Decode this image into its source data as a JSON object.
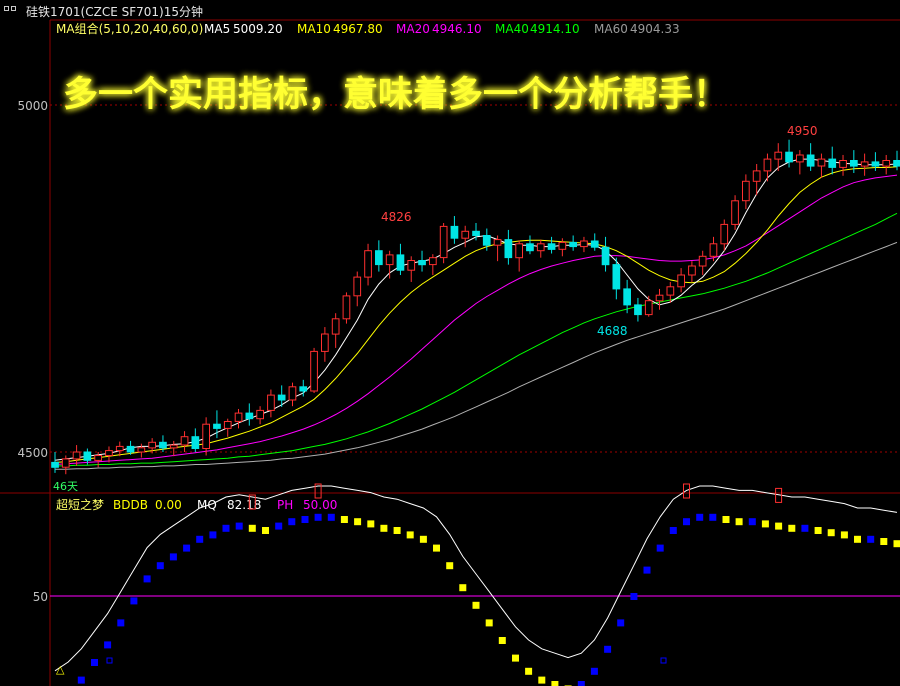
{
  "window": {
    "title": "硅铁1701(CZCE SF701)15分钟"
  },
  "banner": "多一个实用指标，意味着多一个分析帮手！",
  "colors": {
    "background": "#000000",
    "axis": "#8b0000",
    "up": "#ff3030",
    "down": "#00e5e5",
    "ma5": "#ffffff",
    "ma10": "#ffff00",
    "ma20": "#ff00ff",
    "ma40": "#00ff00",
    "ma60": "#b0b0b0",
    "banner": "#ffff33",
    "bddb": "#ffff00",
    "mq": "#ffffff",
    "ph": "#ff00ff",
    "blue": "#0000ff"
  },
  "main_legend": {
    "group_label": "MA组合(5,10,20,40,60,0)",
    "items": [
      {
        "name": "MA5",
        "value": "5009.20",
        "color": "#ffffff"
      },
      {
        "name": "MA10",
        "value": "4967.80",
        "color": "#ffff00"
      },
      {
        "name": "MA20",
        "value": "4946.10",
        "color": "#ff00ff"
      },
      {
        "name": "MA40",
        "value": "4914.10",
        "color": "#00ff00"
      },
      {
        "name": "MA60",
        "value": "4904.33",
        "color": "#9a9a9a"
      }
    ]
  },
  "sub_legend": {
    "name": "超短之梦",
    "items": [
      {
        "name": "BDDB",
        "value": "0.00",
        "color": "#ffff00"
      },
      {
        "name": "MQ",
        "value": "82.18",
        "color": "#ffffff"
      },
      {
        "name": "PH",
        "value": "50.00",
        "color": "#ff00ff"
      }
    ]
  },
  "annotations": {
    "high1": "4826",
    "low1": "4688",
    "high2": "4950",
    "days": "46天",
    "triangle": "△"
  },
  "chart_data": [
    {
      "type": "candlestick",
      "ylim": [
        4480,
        5050
      ],
      "y_ticks": [
        5000,
        4500
      ],
      "ohlc": [
        [
          4485,
          4500,
          4470,
          4478
        ],
        [
          4478,
          4495,
          4468,
          4490
        ],
        [
          4490,
          4510,
          4480,
          4500
        ],
        [
          4500,
          4505,
          4482,
          4488
        ],
        [
          4488,
          4500,
          4478,
          4495
        ],
        [
          4495,
          4508,
          4485,
          4502
        ],
        [
          4502,
          4515,
          4494,
          4508
        ],
        [
          4508,
          4516,
          4496,
          4500
        ],
        [
          4500,
          4512,
          4492,
          4506
        ],
        [
          4506,
          4520,
          4498,
          4514
        ],
        [
          4514,
          4524,
          4500,
          4506
        ],
        [
          4506,
          4516,
          4494,
          4510
        ],
        [
          4510,
          4530,
          4500,
          4522
        ],
        [
          4522,
          4534,
          4500,
          4505
        ],
        [
          4505,
          4550,
          4495,
          4540
        ],
        [
          4540,
          4560,
          4520,
          4534
        ],
        [
          4534,
          4548,
          4522,
          4544
        ],
        [
          4544,
          4562,
          4534,
          4556
        ],
        [
          4556,
          4570,
          4538,
          4548
        ],
        [
          4548,
          4566,
          4540,
          4560
        ],
        [
          4560,
          4590,
          4550,
          4582
        ],
        [
          4582,
          4596,
          4565,
          4575
        ],
        [
          4575,
          4600,
          4566,
          4594
        ],
        [
          4594,
          4604,
          4580,
          4588
        ],
        [
          4588,
          4650,
          4585,
          4645
        ],
        [
          4645,
          4680,
          4630,
          4670
        ],
        [
          4670,
          4700,
          4650,
          4692
        ],
        [
          4692,
          4730,
          4685,
          4725
        ],
        [
          4725,
          4760,
          4710,
          4752
        ],
        [
          4752,
          4800,
          4740,
          4790
        ],
        [
          4790,
          4805,
          4760,
          4770
        ],
        [
          4770,
          4790,
          4750,
          4784
        ],
        [
          4784,
          4800,
          4755,
          4762
        ],
        [
          4762,
          4782,
          4745,
          4776
        ],
        [
          4776,
          4790,
          4760,
          4770
        ],
        [
          4770,
          4785,
          4755,
          4780
        ],
        [
          4780,
          4830,
          4772,
          4825
        ],
        [
          4825,
          4840,
          4800,
          4808
        ],
        [
          4808,
          4826,
          4795,
          4818
        ],
        [
          4818,
          4830,
          4805,
          4812
        ],
        [
          4812,
          4822,
          4790,
          4798
        ],
        [
          4798,
          4812,
          4775,
          4806
        ],
        [
          4806,
          4820,
          4770,
          4780
        ],
        [
          4780,
          4805,
          4760,
          4800
        ],
        [
          4800,
          4812,
          4785,
          4790
        ],
        [
          4790,
          4806,
          4780,
          4800
        ],
        [
          4800,
          4810,
          4786,
          4792
        ],
        [
          4792,
          4808,
          4782,
          4802
        ],
        [
          4802,
          4812,
          4790,
          4796
        ],
        [
          4796,
          4810,
          4788,
          4804
        ],
        [
          4804,
          4815,
          4790,
          4795
        ],
        [
          4795,
          4810,
          4760,
          4770
        ],
        [
          4770,
          4780,
          4720,
          4735
        ],
        [
          4735,
          4748,
          4700,
          4712
        ],
        [
          4712,
          4722,
          4688,
          4698
        ],
        [
          4698,
          4725,
          4695,
          4718
        ],
        [
          4718,
          4735,
          4705,
          4726
        ],
        [
          4726,
          4745,
          4715,
          4738
        ],
        [
          4738,
          4765,
          4730,
          4755
        ],
        [
          4755,
          4775,
          4745,
          4768
        ],
        [
          4768,
          4790,
          4755,
          4782
        ],
        [
          4782,
          4810,
          4775,
          4800
        ],
        [
          4800,
          4835,
          4790,
          4828
        ],
        [
          4828,
          4870,
          4820,
          4862
        ],
        [
          4862,
          4900,
          4850,
          4890
        ],
        [
          4890,
          4915,
          4870,
          4905
        ],
        [
          4905,
          4930,
          4890,
          4922
        ],
        [
          4922,
          4945,
          4905,
          4932
        ],
        [
          4932,
          4950,
          4910,
          4918
        ],
        [
          4918,
          4935,
          4900,
          4928
        ],
        [
          4928,
          4945,
          4905,
          4912
        ],
        [
          4912,
          4930,
          4895,
          4922
        ],
        [
          4922,
          4940,
          4900,
          4910
        ],
        [
          4910,
          4928,
          4898,
          4920
        ],
        [
          4920,
          4935,
          4902,
          4912
        ],
        [
          4912,
          4930,
          4898,
          4918
        ],
        [
          4918,
          4932,
          4905,
          4912
        ],
        [
          4912,
          4928,
          4900,
          4920
        ],
        [
          4920,
          4934,
          4906,
          4912
        ]
      ],
      "ma5": [
        4488,
        4490,
        4492,
        4494,
        4496,
        4498,
        4502,
        4506,
        4508,
        4508,
        4509,
        4511,
        4512,
        4515,
        4520,
        4528,
        4535,
        4542,
        4548,
        4554,
        4560,
        4568,
        4578,
        4585,
        4600,
        4618,
        4640,
        4665,
        4690,
        4720,
        4742,
        4758,
        4768,
        4772,
        4775,
        4778,
        4786,
        4795,
        4802,
        4810,
        4812,
        4806,
        4800,
        4798,
        4798,
        4796,
        4796,
        4798,
        4798,
        4799,
        4798,
        4790,
        4775,
        4755,
        4735,
        4720,
        4712,
        4716,
        4726,
        4740,
        4752,
        4770,
        4790,
        4815,
        4845,
        4872,
        4895,
        4910,
        4918,
        4922,
        4922,
        4920,
        4918,
        4916,
        4915,
        4914,
        4914,
        4914,
        4915
      ],
      "ma10": [
        4485,
        4486,
        4488,
        4490,
        4492,
        4494,
        4496,
        4498,
        4500,
        4502,
        4504,
        4506,
        4508,
        4510,
        4512,
        4516,
        4520,
        4525,
        4530,
        4536,
        4542,
        4550,
        4558,
        4566,
        4576,
        4590,
        4606,
        4624,
        4642,
        4662,
        4682,
        4700,
        4716,
        4730,
        4742,
        4752,
        4762,
        4772,
        4782,
        4790,
        4796,
        4800,
        4802,
        4804,
        4805,
        4805,
        4804,
        4803,
        4802,
        4801,
        4800,
        4796,
        4790,
        4782,
        4772,
        4762,
        4754,
        4748,
        4745,
        4744,
        4746,
        4752,
        4760,
        4772,
        4786,
        4802,
        4820,
        4840,
        4858,
        4874,
        4886,
        4896,
        4902,
        4906,
        4908,
        4909,
        4910,
        4910,
        4911
      ],
      "ma20": [
        4482,
        4483,
        4484,
        4485,
        4486,
        4487,
        4488,
        4489,
        4490,
        4491,
        4493,
        4495,
        4497,
        4499,
        4501,
        4503,
        4506,
        4509,
        4512,
        4515,
        4519,
        4523,
        4528,
        4533,
        4539,
        4546,
        4554,
        4563,
        4573,
        4584,
        4596,
        4608,
        4621,
        4634,
        4648,
        4662,
        4676,
        4690,
        4702,
        4714,
        4724,
        4733,
        4742,
        4750,
        4757,
        4763,
        4768,
        4772,
        4776,
        4779,
        4782,
        4783,
        4783,
        4782,
        4780,
        4778,
        4776,
        4775,
        4775,
        4776,
        4777,
        4780,
        4784,
        4790,
        4797,
        4806,
        4816,
        4826,
        4836,
        4846,
        4856,
        4866,
        4874,
        4882,
        4888,
        4892,
        4895,
        4897,
        4899
      ],
      "ma40": [
        4480,
        4480,
        4481,
        4481,
        4482,
        4482,
        4483,
        4483,
        4484,
        4484,
        4485,
        4486,
        4487,
        4488,
        4489,
        4490,
        4491,
        4493,
        4494,
        4496,
        4498,
        4500,
        4502,
        4505,
        4508,
        4511,
        4515,
        4519,
        4524,
        4529,
        4535,
        4541,
        4548,
        4555,
        4562,
        4570,
        4578,
        4586,
        4595,
        4604,
        4613,
        4622,
        4631,
        4640,
        4648,
        4656,
        4664,
        4672,
        4679,
        4686,
        4692,
        4697,
        4702,
        4706,
        4710,
        4713,
        4716,
        4719,
        4722,
        4725,
        4728,
        4732,
        4736,
        4741,
        4746,
        4752,
        4758,
        4765,
        4772,
        4779,
        4786,
        4793,
        4800,
        4807,
        4814,
        4821,
        4828,
        4836,
        4844
      ],
      "ma60": [
        4475,
        4475,
        4476,
        4476,
        4477,
        4477,
        4478,
        4478,
        4479,
        4479,
        4480,
        4480,
        4481,
        4482,
        4482,
        4483,
        4484,
        4485,
        4486,
        4487,
        4488,
        4490,
        4491,
        4493,
        4495,
        4497,
        4500,
        4503,
        4506,
        4510,
        4514,
        4518,
        4523,
        4528,
        4533,
        4539,
        4545,
        4551,
        4558,
        4565,
        4572,
        4579,
        4586,
        4594,
        4601,
        4608,
        4615,
        4622,
        4629,
        4636,
        4643,
        4649,
        4655,
        4661,
        4666,
        4671,
        4676,
        4681,
        4686,
        4691,
        4696,
        4701,
        4706,
        4712,
        4718,
        4724,
        4730,
        4736,
        4742,
        4748,
        4754,
        4760,
        4766,
        4772,
        4778,
        4784,
        4790,
        4796,
        4802
      ]
    },
    {
      "type": "indicator",
      "ylim": [
        0,
        100
      ],
      "y_ticks": [
        50
      ],
      "ph_level": 50,
      "mq": [
        16,
        20,
        26,
        34,
        42,
        52,
        62,
        72,
        78,
        82,
        86,
        90,
        92,
        95,
        96,
        95,
        94,
        96,
        98,
        99,
        100,
        100,
        99,
        98,
        97,
        95,
        94,
        92,
        90,
        86,
        78,
        68,
        60,
        52,
        44,
        36,
        30,
        26,
        24,
        22,
        24,
        30,
        40,
        52,
        64,
        76,
        86,
        94,
        98,
        100,
        100,
        99,
        98,
        98,
        97,
        96,
        95,
        95,
        94,
        93,
        92,
        90,
        90,
        89,
        88
      ]
    }
  ]
}
